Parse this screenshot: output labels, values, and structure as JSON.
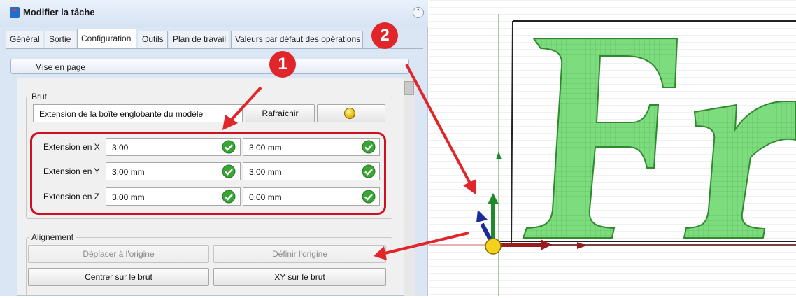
{
  "dialog": {
    "title": "Modifier la tâche",
    "collapse_symbol": "⌃",
    "tabs": [
      {
        "label": "Général"
      },
      {
        "label": "Sortie"
      },
      {
        "label": "Configuration"
      },
      {
        "label": "Outils"
      },
      {
        "label": "Plan de travail"
      },
      {
        "label": "Valeurs par défaut des opérations"
      }
    ],
    "section": "Mise en page",
    "brut": {
      "group_label": "Brut",
      "mode_label": "Extension de la boîte englobante du modèle",
      "refresh_label": "Rafraîchir",
      "rows": [
        {
          "label": "Extension en X",
          "v1": "3,00",
          "v2": "3,00 mm"
        },
        {
          "label": "Extension en Y",
          "v1": "3,00 mm",
          "v2": "3,00 mm"
        },
        {
          "label": "Extension en Z",
          "v1": "3,00 mm",
          "v2": "0,00 mm"
        }
      ]
    },
    "alignement": {
      "group_label": "Alignement",
      "move_origin": "Déplacer à l'origine",
      "define_origin": "Définir l'origine",
      "center_stock": "Centrer sur le brut",
      "xy_stock": "XY sur le brut"
    }
  },
  "badges": {
    "one": "1",
    "two": "2"
  },
  "viewport": {
    "text": "Fr"
  },
  "colors": {
    "highlight": "#cf1020",
    "letter_fill": "#7ddc7d",
    "check_green": "#3aa535",
    "axis_x": "#9b1c1c",
    "axis_y": "#1f8a2a",
    "axis_z": "#1c2a9b"
  }
}
